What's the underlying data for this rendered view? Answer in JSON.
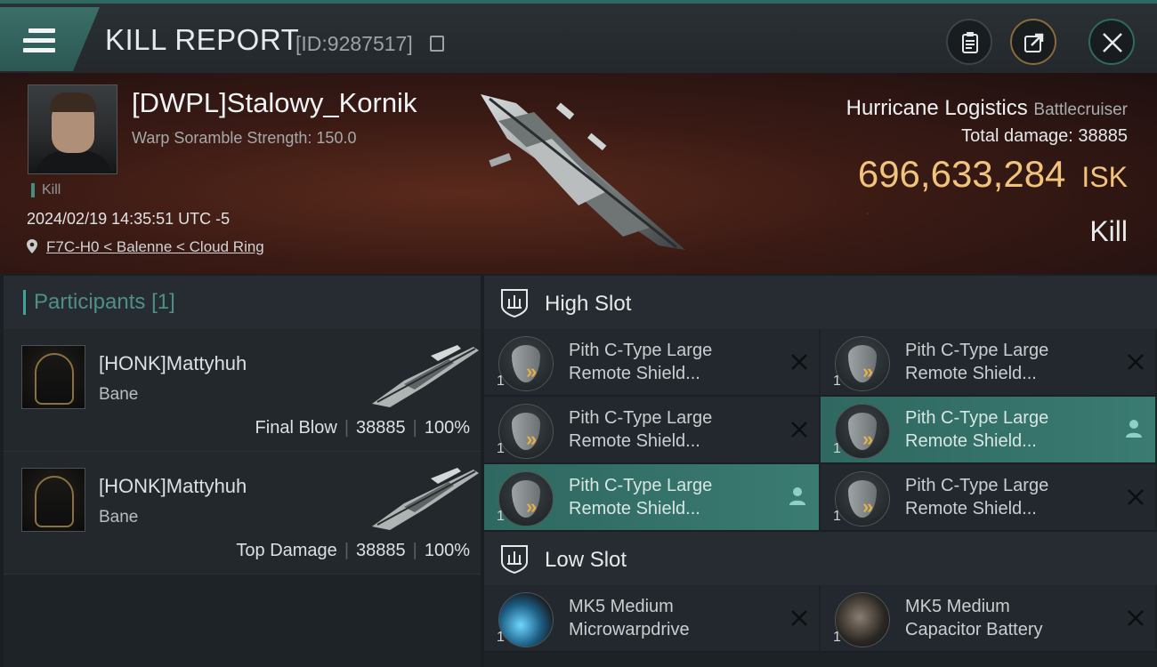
{
  "header": {
    "title": "KILL REPORT",
    "report_id": "[ID:9287517]"
  },
  "victim": {
    "name": "[DWPL]Stalowy_Kornik",
    "scramble": "Warp Soramble Strength: 150.0",
    "tag": "Kill",
    "timestamp": "2024/02/19 14:35:51 UTC -5",
    "location": "F7C-H0 < Balenne < Cloud Ring",
    "ship_name": "Hurricane Logistics",
    "ship_class": "Battlecruiser",
    "total_damage_label": "Total damage:",
    "total_damage": "38885",
    "isk_value": "696,633,284",
    "isk_unit": "ISK",
    "outcome": "Kill"
  },
  "participants": {
    "label": "Participants",
    "count": "[1]",
    "rows": [
      {
        "name": "[HONK]Mattyhuh",
        "ship": "Bane",
        "role": "Final Blow",
        "damage": "38885",
        "percent": "100%"
      },
      {
        "name": "[HONK]Mattyhuh",
        "ship": "Bane",
        "role": "Top Damage",
        "damage": "38885",
        "percent": "100%"
      }
    ]
  },
  "high_slot": {
    "label": "High Slot",
    "modules": [
      {
        "name_line1": "Pith C-Type Large",
        "name_line2": "Remote Shield...",
        "qty": "1",
        "state": "destroyed"
      },
      {
        "name_line1": "Pith C-Type Large",
        "name_line2": "Remote Shield...",
        "qty": "1",
        "state": "destroyed"
      },
      {
        "name_line1": "Pith C-Type Large",
        "name_line2": "Remote Shield...",
        "qty": "1",
        "state": "destroyed"
      },
      {
        "name_line1": "Pith C-Type Large",
        "name_line2": "Remote Shield...",
        "qty": "1",
        "state": "dropped"
      },
      {
        "name_line1": "Pith C-Type Large",
        "name_line2": "Remote Shield...",
        "qty": "1",
        "state": "dropped"
      },
      {
        "name_line1": "Pith C-Type Large",
        "name_line2": "Remote Shield...",
        "qty": "1",
        "state": "destroyed"
      }
    ]
  },
  "low_slot": {
    "label": "Low Slot",
    "modules": [
      {
        "name_line1": "MK5 Medium",
        "name_line2": "Microwarpdrive",
        "qty": "1",
        "state": "destroyed"
      },
      {
        "name_line1": "MK5 Medium",
        "name_line2": "Capacitor Battery",
        "qty": "1",
        "state": "destroyed"
      }
    ]
  },
  "colors": {
    "accent": "#3a7b72",
    "isk": "#f0c47a",
    "banner": "#5a2a1c"
  }
}
